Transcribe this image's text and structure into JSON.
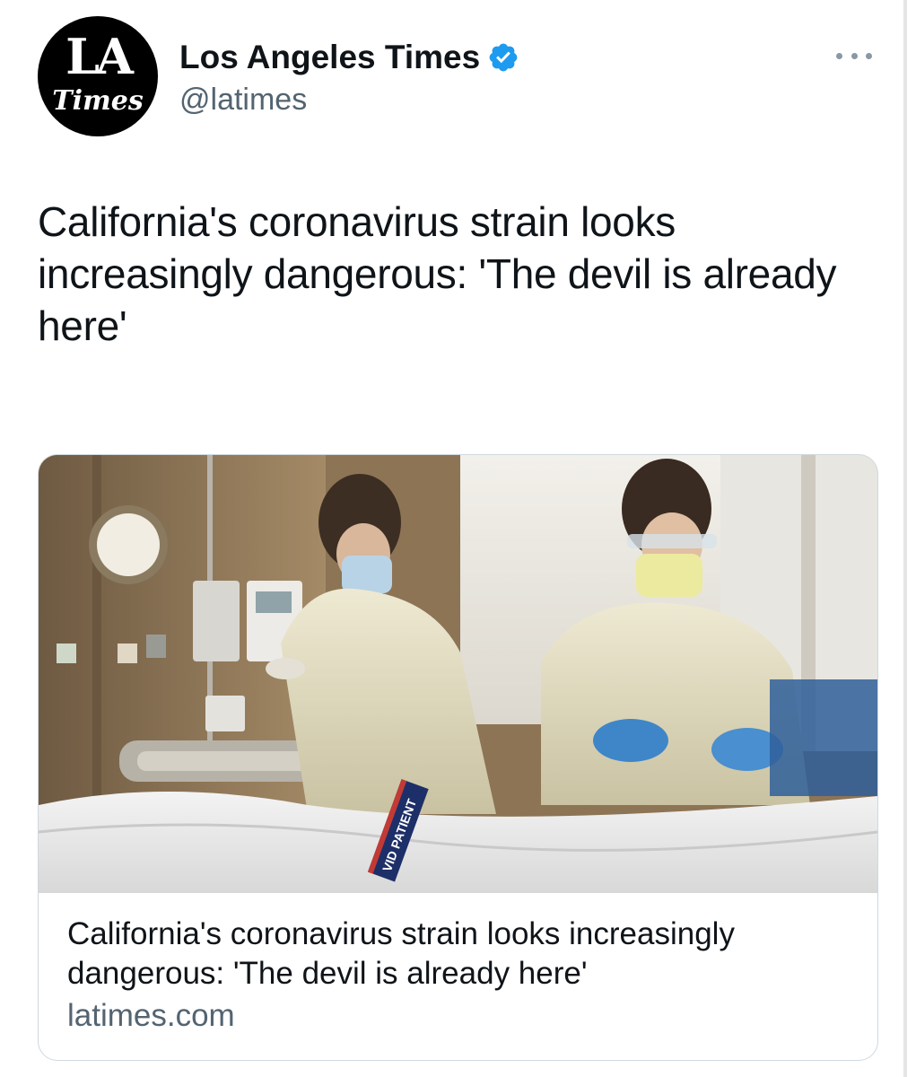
{
  "account": {
    "display_name": "Los Angeles Times",
    "handle": "@latimes",
    "verified": true,
    "avatar_text_top": "LA",
    "avatar_text_bottom": "Times"
  },
  "tweet": {
    "text": "California's coronavirus strain looks increasingly dangerous: 'The devil is already here'"
  },
  "link_card": {
    "image_label": "VID PATIENT",
    "title": "California's coronavirus strain looks increasingly dangerous: 'The devil is already here'",
    "domain": "latimes.com"
  },
  "icons": {
    "verified": "verified-badge-icon",
    "more": "more-options-icon"
  },
  "colors": {
    "verified_blue": "#1d9bf0",
    "secondary_text": "#536471",
    "primary_text": "#0f1419",
    "card_border": "#cfd9de"
  }
}
